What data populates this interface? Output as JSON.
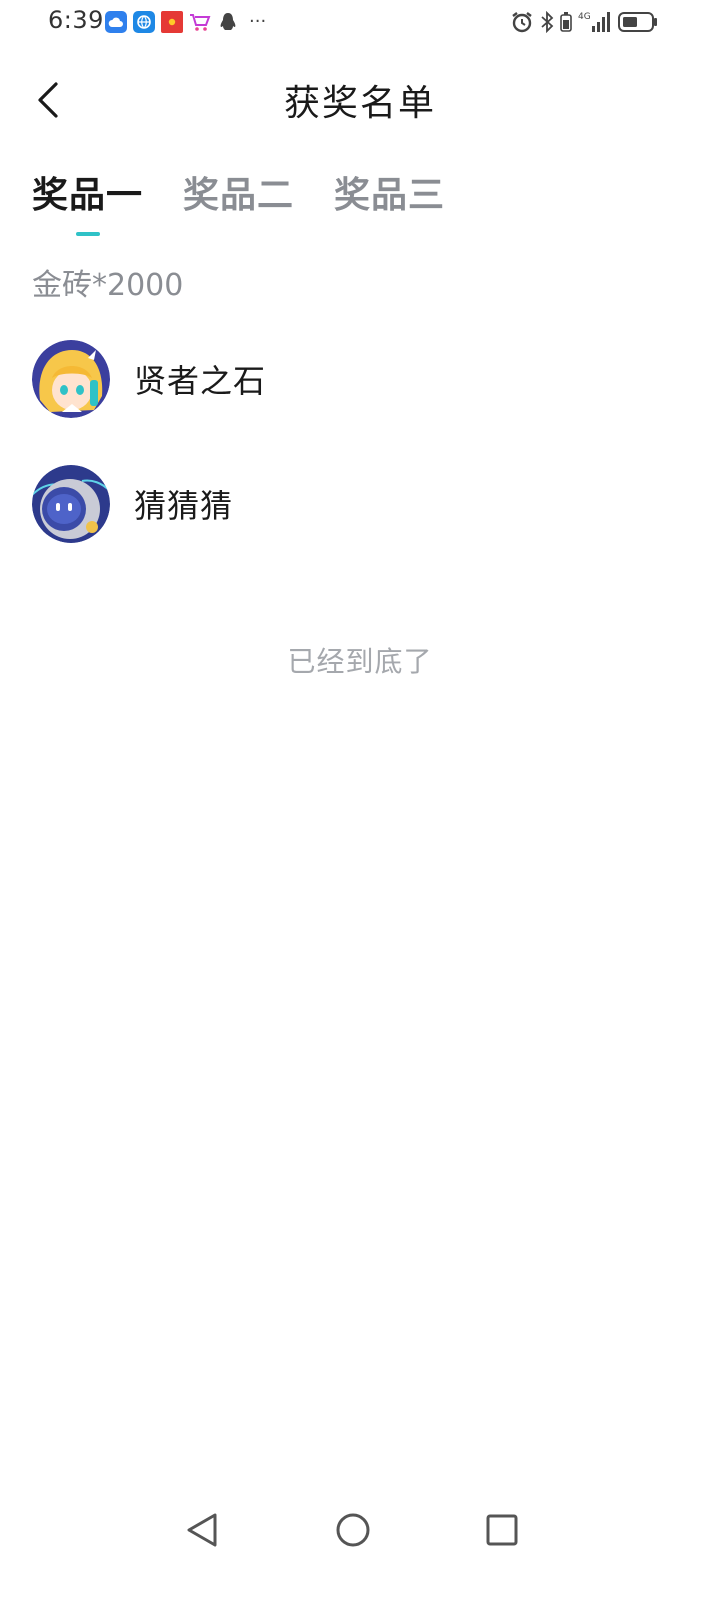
{
  "status_bar": {
    "time": "6:39",
    "left_icons": [
      "cloud-icon",
      "globe-icon",
      "red-packet-icon",
      "shopping-cart-icon",
      "qq-penguin-icon"
    ],
    "more": "···",
    "right_icons": [
      "alarm-icon",
      "bluetooth-icon",
      "signal-4g-icon",
      "battery-icon"
    ],
    "network": "4G"
  },
  "header": {
    "title": "获奖名单",
    "back_icon": "chevron-left-icon"
  },
  "tabs": [
    {
      "label": "奖品一",
      "active": true
    },
    {
      "label": "奖品二",
      "active": false
    },
    {
      "label": "奖品三",
      "active": false
    }
  ],
  "prize": {
    "label": "金砖*2000"
  },
  "winners": [
    {
      "name": "贤者之石",
      "avatar": "anime-girl-avatar"
    },
    {
      "name": "猜猜猜",
      "avatar": "robot-avatar"
    }
  ],
  "end_text": "已经到底了",
  "nav_bar": {
    "back": "triangle-back-icon",
    "home": "circle-home-icon",
    "recents": "square-recents-icon"
  },
  "colors": {
    "accent": "#2fc2c7",
    "muted_text": "#8a8d93",
    "primary_text": "#1a1a1a"
  }
}
